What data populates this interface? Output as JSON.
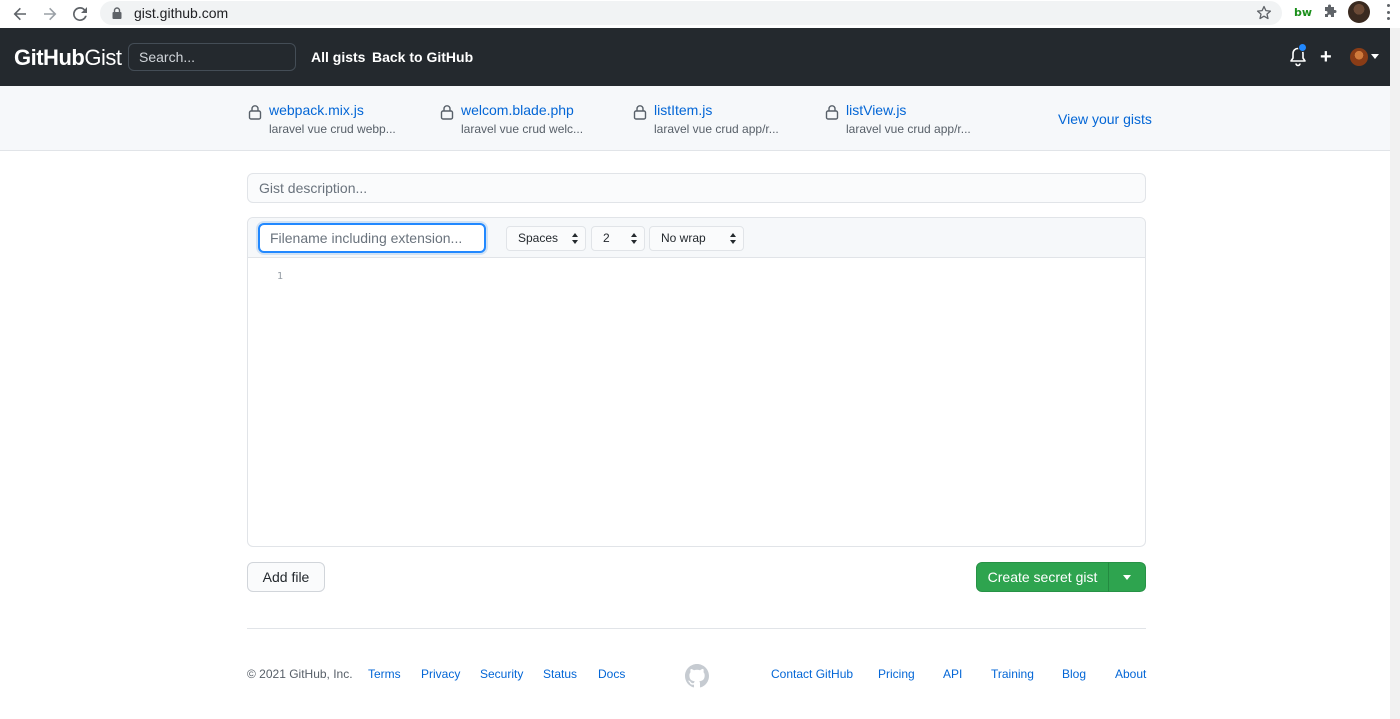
{
  "browser": {
    "url": "gist.github.com",
    "extension_label": "bw"
  },
  "header": {
    "logo_bold": "GitHub",
    "logo_light": "Gist",
    "search_placeholder": "Search...",
    "nav": {
      "all_gists": "All gists",
      "back_to_github": "Back to GitHub"
    },
    "notification_dot_color": "#2188ff"
  },
  "recent_gists": {
    "items": [
      {
        "name": "webpack.mix.js",
        "desc": "laravel vue crud webp..."
      },
      {
        "name": "welcom.blade.php",
        "desc": "laravel vue crud welc..."
      },
      {
        "name": "listItem.js",
        "desc": "laravel vue crud app/r..."
      },
      {
        "name": "listView.js",
        "desc": "laravel vue crud app/r..."
      }
    ],
    "view_all": "View your gists"
  },
  "form": {
    "description_placeholder": "Gist description...",
    "filename_placeholder": "Filename including extension...",
    "indent_mode": "Spaces",
    "indent_size": "2",
    "wrap_mode": "No wrap",
    "line_numbers": [
      "1"
    ],
    "add_file_label": "Add file",
    "create_label": "Create secret gist",
    "create_color": "#2ea44f"
  },
  "footer": {
    "copyright": "© 2021 GitHub, Inc.",
    "links_left": [
      "Terms",
      "Privacy",
      "Security",
      "Status",
      "Docs"
    ],
    "links_right": [
      "Contact GitHub",
      "Pricing",
      "API",
      "Training",
      "Blog",
      "About"
    ]
  }
}
